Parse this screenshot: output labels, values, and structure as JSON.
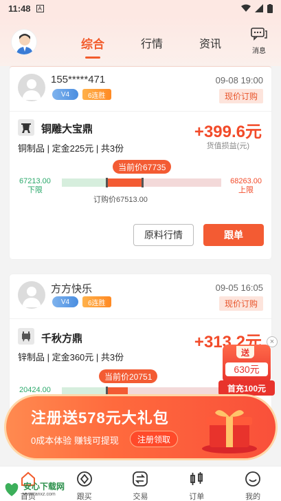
{
  "status": {
    "time": "11:48",
    "a_icon": "A"
  },
  "header": {
    "tabs": [
      "综合",
      "行情",
      "资讯"
    ],
    "active_tab": 0,
    "message_label": "消息"
  },
  "cards": [
    {
      "user": "155*****471",
      "level": "V4",
      "streak": "6连胜",
      "time": "09-08 19:00",
      "order_type": "现价订购",
      "product": "铜雕大宝鼎",
      "meta": "铜制品 | 定金225元 | 共3份",
      "profit": "+399.6元",
      "profit_label": "货值损益(元)",
      "current_price": "当前价67735",
      "lower_value": "67213.00",
      "lower_label": "下限",
      "upper_value": "68263.00",
      "upper_label": "上限",
      "buy_price": "订购价67513.00",
      "btn_market": "原料行情",
      "btn_follow": "跟单"
    },
    {
      "user": "方方快乐",
      "level": "V4",
      "streak": "6连胜",
      "time": "09-05 16:05",
      "order_type": "现价订购",
      "product": "千秋方鼎",
      "meta": "锌制品 | 定金360元 | 共3份",
      "profit": "+313.2元",
      "profit_label": "货值",
      "current_price": "当前价20751",
      "lower_value": "20424.00"
    }
  ],
  "float_widget": {
    "top": "送",
    "amount": "630元",
    "button": "首充100元",
    "close": "×"
  },
  "banner": {
    "title": "注册送578元大礼包",
    "subtitle": "0成本体验 赚钱可提现",
    "button": "注册领取"
  },
  "nav": [
    "首页",
    "跟买",
    "交易",
    "订单",
    "我的"
  ],
  "watermark": {
    "main": "安心下载网",
    "url": "www.anxz.com"
  },
  "colors": {
    "accent": "#f25c2c",
    "green": "#2aa86a"
  }
}
